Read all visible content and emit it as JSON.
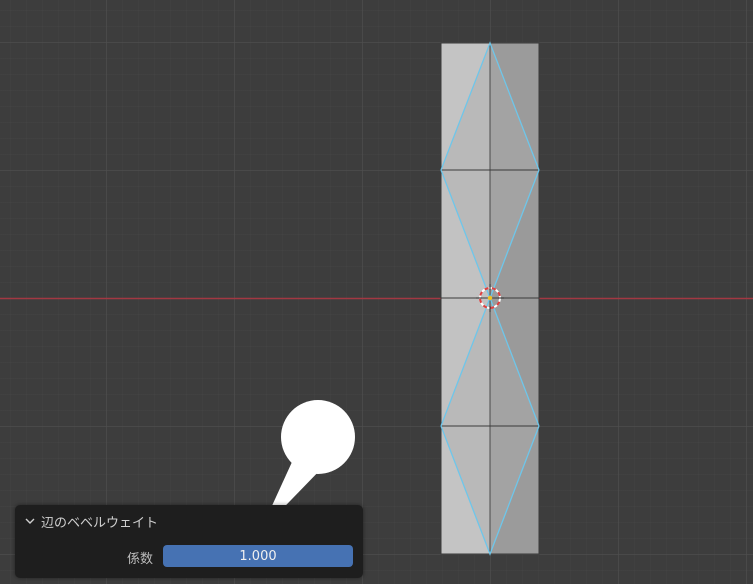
{
  "viewport": {
    "object": "mesh-column",
    "colors": {
      "background": "#3d3d3d",
      "x_axis": "#a33843",
      "edge_selected": "#6ec6ea",
      "face_light": "#b9b9b9",
      "face_dark": "#a3a3a3",
      "cursor": "#e04040"
    }
  },
  "operator_panel": {
    "title": "辺のベベルウェイト",
    "collapse_icon": "chevron-down-icon",
    "factor_label": "係数",
    "factor_value": "1.000",
    "accent_color": "#4672b3"
  },
  "callout": {
    "icon": "speech-bubble-pointer"
  }
}
